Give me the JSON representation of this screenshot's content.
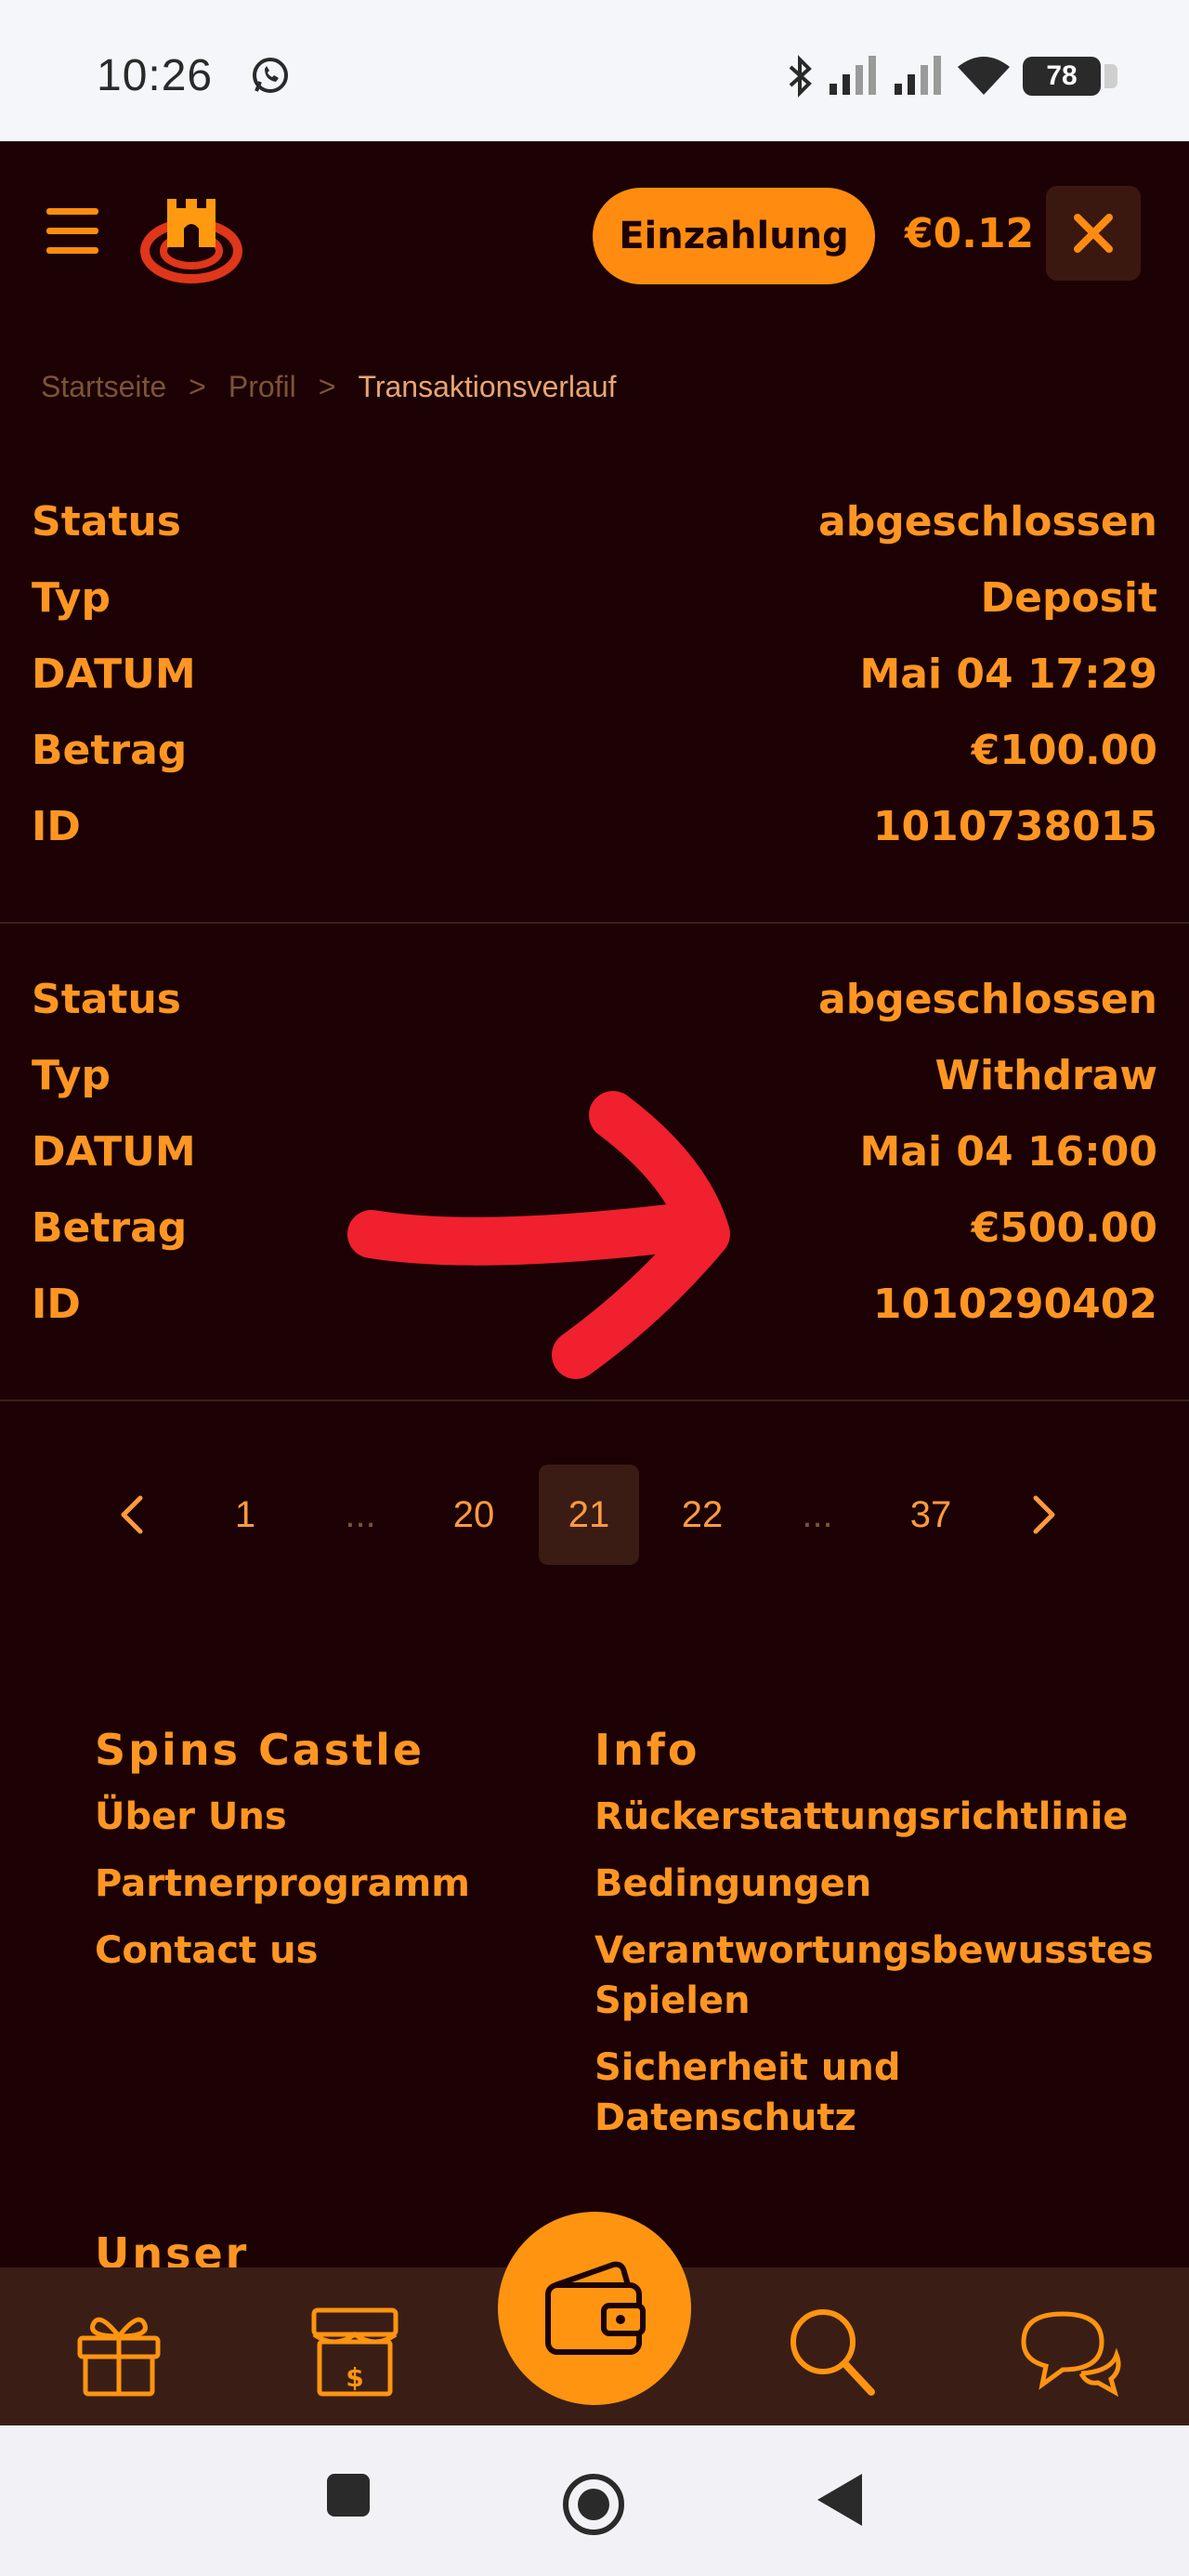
{
  "status_bar": {
    "time": "10:26",
    "battery": "78",
    "icons": [
      "whatsapp-icon",
      "bluetooth-icon",
      "signal-icon",
      "signal-icon",
      "wifi-icon",
      "battery-icon"
    ]
  },
  "header": {
    "menu_icon": "hamburger-menu-icon",
    "logo_icon": "castle-logo-icon",
    "deposit_label": "Einzahlung",
    "balance": "€0.12",
    "close_icon": "close-icon"
  },
  "breadcrumb": {
    "items": [
      "Startseite",
      "Profil",
      "Transaktionsverlauf"
    ],
    "separator": ">"
  },
  "transactions": [
    {
      "status_label": "Status",
      "status": "abgeschlossen",
      "type_label": "Typ",
      "type": "Deposit",
      "date_label": "DATUM",
      "date": "Mai 04 17:29",
      "amount_label": "Betrag",
      "amount": "€100.00",
      "id_label": "ID",
      "id": "1010738015"
    },
    {
      "status_label": "Status",
      "status": "abgeschlossen",
      "type_label": "Typ",
      "type": "Withdraw",
      "date_label": "DATUM",
      "date": "Mai 04 16:00",
      "amount_label": "Betrag",
      "amount": "€500.00",
      "id_label": "ID",
      "id": "1010290402"
    }
  ],
  "annotation": {
    "color": "#f0202e",
    "shape": "arrow-right"
  },
  "pagination": {
    "prev_icon": "chevron-left-icon",
    "next_icon": "chevron-right-icon",
    "pages": [
      "1",
      "...",
      "20",
      "21",
      "22",
      "...",
      "37"
    ],
    "current": "21"
  },
  "footer": {
    "col1": {
      "title": "Spins Castle",
      "links": [
        "Über Uns",
        "Partnerprogramm",
        "Contact us"
      ]
    },
    "col2": {
      "title": "Info",
      "links": [
        "Rückerstattungsrichtlinie",
        "Bedingungen",
        "Verantwortungsbewusstes Spielen",
        "Sicherheit und Datenschutz"
      ]
    },
    "partial_title": "Unser"
  },
  "bottom_nav": {
    "items": [
      "gift-icon",
      "shop-icon",
      "wallet-icon",
      "search-icon",
      "chat-icon"
    ]
  },
  "colors": {
    "background": "#1c0204",
    "accent": "#ff8c10",
    "nav_bg": "#3a1e16"
  }
}
